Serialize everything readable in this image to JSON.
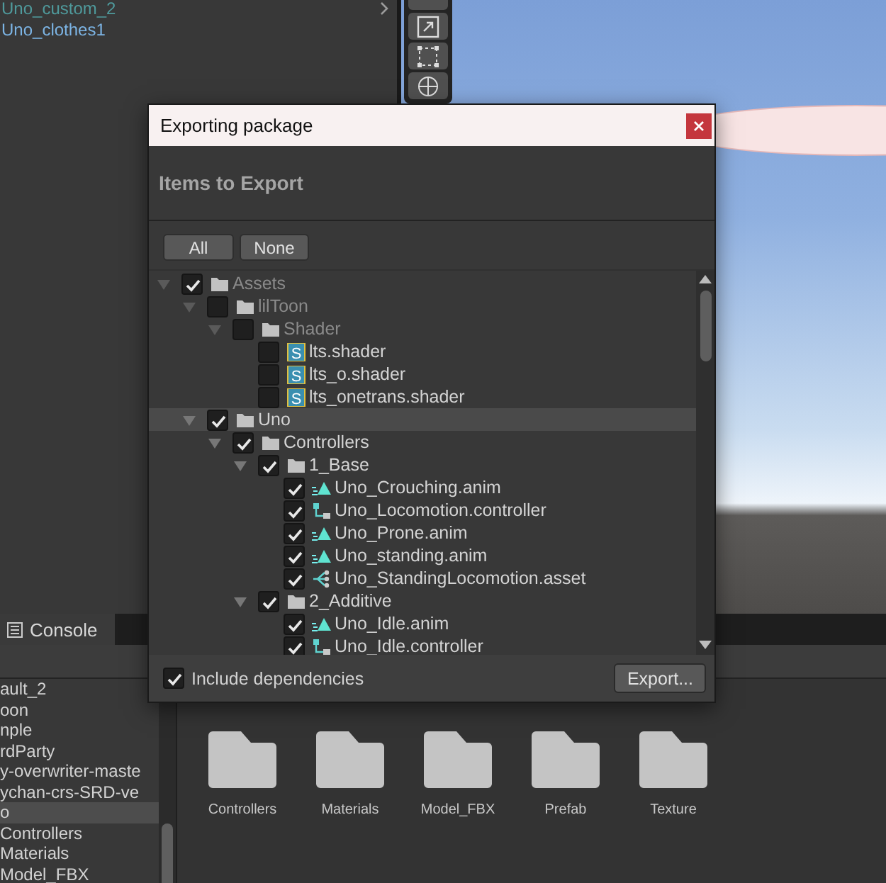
{
  "hierarchy": {
    "items": [
      {
        "label": "Uno_custom_2",
        "color": "#4f9a9c",
        "has_children": true
      },
      {
        "label": "Uno_clothes1",
        "color": "#7cb4e4",
        "has_children": false
      }
    ]
  },
  "console_tab": {
    "label": "Console"
  },
  "project": {
    "folders": [
      {
        "label": "ault_2",
        "selected": false
      },
      {
        "label": "oon",
        "selected": false
      },
      {
        "label": "nple",
        "selected": false
      },
      {
        "label": "rdParty",
        "selected": false
      },
      {
        "label": "y-overwriter-maste",
        "selected": false
      },
      {
        "label": "ychan-crs-SRD-ve",
        "selected": false
      },
      {
        "label": "o",
        "selected": true
      },
      {
        "label": "Controllers",
        "selected": false
      },
      {
        "label": "Materials",
        "selected": false
      },
      {
        "label": "Model_FBX",
        "selected": false
      }
    ],
    "grid": [
      {
        "label": "Controllers"
      },
      {
        "label": "Materials"
      },
      {
        "label": "Model_FBX"
      },
      {
        "label": "Prefab"
      },
      {
        "label": "Texture"
      }
    ]
  },
  "dialog": {
    "title": "Exporting package",
    "heading": "Items to Export",
    "buttons": [
      {
        "label": "All"
      },
      {
        "label": "None"
      }
    ],
    "tree": [
      {
        "label": "Assets",
        "kind": "folder",
        "checked": true,
        "dimmed": true,
        "selected": false,
        "expanded": true,
        "children": [
          {
            "label": "lilToon",
            "kind": "folder",
            "checked": false,
            "dimmed": true,
            "selected": false,
            "expanded": true,
            "children": [
              {
                "label": "Shader",
                "kind": "folder",
                "checked": false,
                "dimmed": true,
                "selected": false,
                "expanded": true,
                "children": [
                  {
                    "label": "lts.shader",
                    "kind": "shader",
                    "icon_text": "S",
                    "checked": false,
                    "dimmed": false,
                    "selected": false
                  },
                  {
                    "label": "lts_o.shader",
                    "kind": "shader",
                    "icon_text": "S",
                    "checked": false,
                    "dimmed": false,
                    "selected": false
                  },
                  {
                    "label": "lts_onetrans.shader",
                    "kind": "shader",
                    "icon_text": "S",
                    "checked": false,
                    "dimmed": false,
                    "selected": false
                  }
                ]
              }
            ]
          },
          {
            "label": "Uno",
            "kind": "folder",
            "checked": true,
            "dimmed": false,
            "selected": true,
            "expanded": true,
            "children": [
              {
                "label": "Controllers",
                "kind": "folder",
                "checked": true,
                "dimmed": false,
                "selected": false,
                "expanded": true,
                "children": [
                  {
                    "label": "1_Base",
                    "kind": "folder",
                    "checked": true,
                    "dimmed": false,
                    "selected": false,
                    "expanded": true,
                    "children": [
                      {
                        "label": "Uno_Crouching.anim",
                        "kind": "anim",
                        "checked": true,
                        "dimmed": false,
                        "selected": false
                      },
                      {
                        "label": "Uno_Locomotion.controller",
                        "kind": "controller",
                        "checked": true,
                        "dimmed": false,
                        "selected": false
                      },
                      {
                        "label": "Uno_Prone.anim",
                        "kind": "anim",
                        "checked": true,
                        "dimmed": false,
                        "selected": false
                      },
                      {
                        "label": "Uno_standing.anim",
                        "kind": "anim",
                        "checked": true,
                        "dimmed": false,
                        "selected": false
                      },
                      {
                        "label": "Uno_StandingLocomotion.asset",
                        "kind": "blendtree",
                        "checked": true,
                        "dimmed": false,
                        "selected": false
                      }
                    ]
                  },
                  {
                    "label": "2_Additive",
                    "kind": "folder",
                    "checked": true,
                    "dimmed": false,
                    "selected": false,
                    "expanded": true,
                    "children": [
                      {
                        "label": "Uno_Idle.anim",
                        "kind": "anim",
                        "checked": true,
                        "dimmed": false,
                        "selected": false
                      },
                      {
                        "label": "Uno_Idle.controller",
                        "kind": "controller",
                        "checked": true,
                        "dimmed": false,
                        "selected": false
                      }
                    ]
                  }
                ]
              }
            ]
          }
        ]
      }
    ],
    "include_dependencies": {
      "label": "Include dependencies",
      "checked": true
    },
    "export_button": {
      "label": "Export..."
    }
  }
}
